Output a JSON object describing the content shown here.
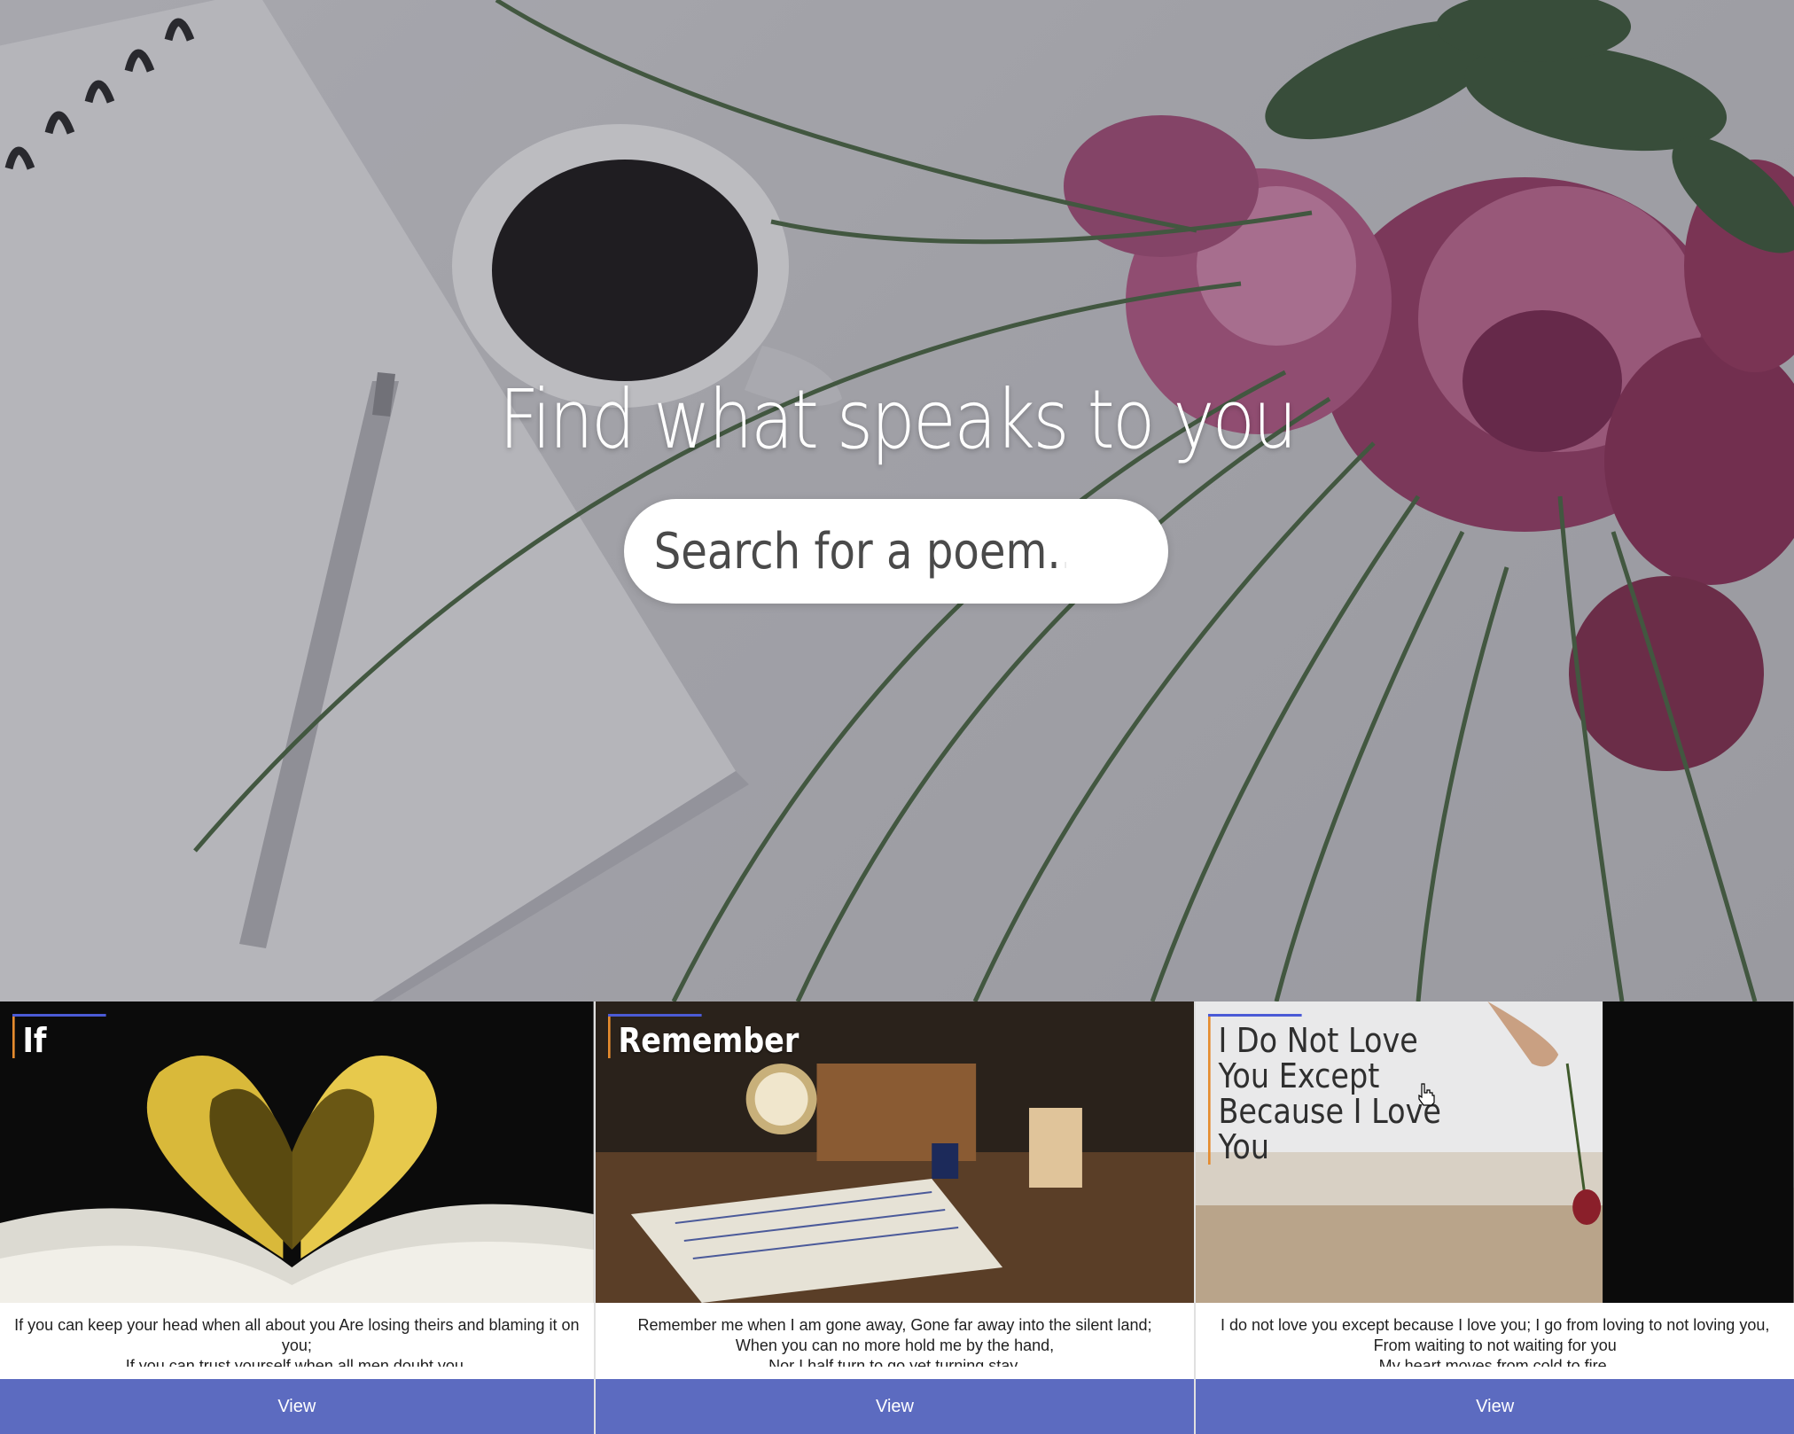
{
  "hero": {
    "title": "Find what speaks to you",
    "search_placeholder": "Search for a poem..."
  },
  "cards": [
    {
      "title": "If",
      "excerpt_lines": [
        "If you can keep your head when all about you Are losing theirs and blaming it on",
        "you;",
        "If you can trust yourself when all men doubt you,"
      ],
      "button_label": "View"
    },
    {
      "title": "Remember",
      "excerpt_lines": [
        "Remember me when I am gone away, Gone far away into the silent land;",
        "When you can no more hold me by the hand,",
        "Nor I half turn to go yet turning stay."
      ],
      "button_label": "View"
    },
    {
      "title": "I Do Not Love You Except Because I Love You",
      "excerpt_lines": [
        "I do not love you except because I love you; I go from loving to not loving you,",
        "From waiting to not waiting for you",
        "My heart moves from cold to fire."
      ],
      "button_label": "View"
    }
  ],
  "colors": {
    "button": "#5c6bc0",
    "title_accent_top": "#4b5bd6",
    "title_accent_left": "#e58b2e"
  }
}
